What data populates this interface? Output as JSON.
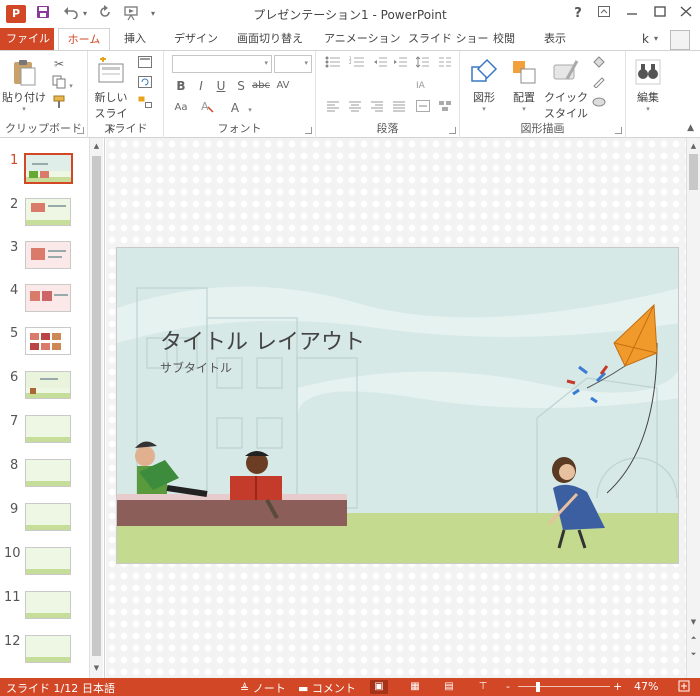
{
  "titlebar": {
    "app_logo": "P",
    "title": "プレゼンテーション1 - PowerPoint",
    "qat_icons": [
      "save-icon",
      "undo-icon",
      "redo-icon",
      "start-from-beginning-icon",
      "customize-qat-icon"
    ],
    "window_buttons": [
      "help-icon",
      "ribbon-display-icon",
      "minimize-icon",
      "maximize-icon",
      "close-icon"
    ],
    "help_label": "?"
  },
  "tabs": {
    "file": "ファイル",
    "home": "ホーム",
    "insert": "挿入",
    "design": "デザイン",
    "transitions": "画面切り替え",
    "animations": "アニメーション",
    "slideshow": "スライド ショー",
    "review": "校閲",
    "view": "表示",
    "user": "k"
  },
  "ribbon": {
    "groups": {
      "clipboard": "クリップボード",
      "slides": "スライド",
      "font": "フォント",
      "paragraph": "段落",
      "drawing": "図形描画",
      "editing": ""
    },
    "paste_label": "貼り付け",
    "new_slide_label_1": "新しい",
    "new_slide_label_2": "スライド",
    "shapes_label": "図形",
    "arrange_label": "配置",
    "quick_styles_label_1": "クイック",
    "quick_styles_label_2": "スタイル",
    "editing_label": "編集",
    "font_buttons": [
      "B",
      "I",
      "U",
      "S",
      "abc",
      "AV",
      "Aa",
      "A",
      "A"
    ],
    "accent_color": "#d24726"
  },
  "thumbnails": {
    "numbers": [
      "1",
      "2",
      "3",
      "4",
      "5",
      "6",
      "7",
      "8",
      "9",
      "10",
      "11",
      "12"
    ],
    "active_index": 1
  },
  "slide": {
    "title": "タイトル レイアウト",
    "subtitle": "サブタイトル"
  },
  "statusbar": {
    "slide_info": "スライド 1/12",
    "language": "日本語",
    "notes": "ノート",
    "comments": "コメント",
    "zoom": "47%",
    "zoom_minus": "-",
    "zoom_plus": "+",
    "background_color": "#d24726"
  }
}
